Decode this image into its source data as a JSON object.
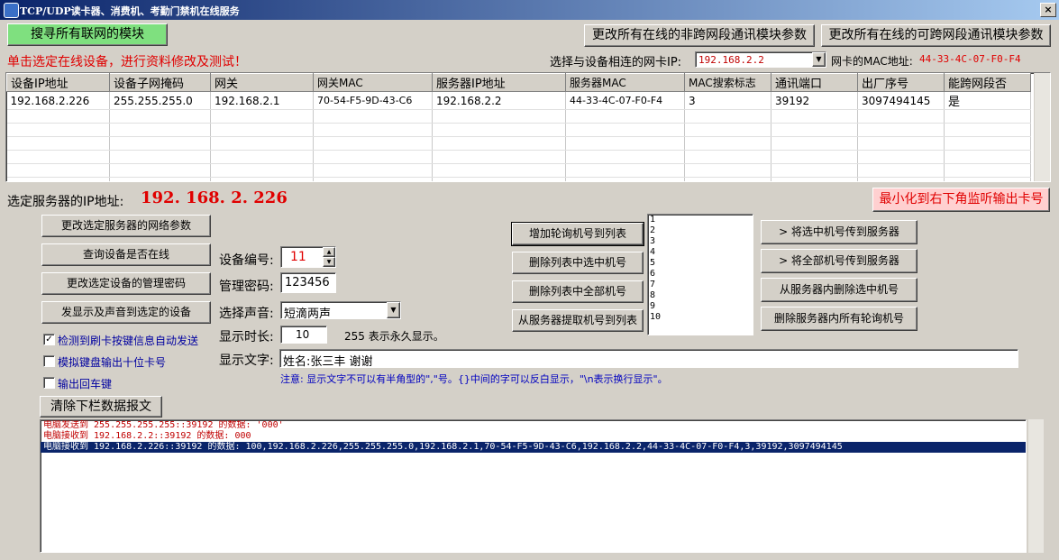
{
  "window": {
    "title": "TCP/UDP读卡器、消费机、考勤门禁机在线服务",
    "close": "×"
  },
  "top": {
    "search_button": "搜寻所有联网的模块",
    "change_non_cross": "更改所有在线的非跨网段通讯模块参数",
    "change_cross": "更改所有在线的可跨网段通讯模块参数",
    "hint": "单击选定在线设备，进行资料修改及测试！",
    "nic_ip_label": "选择与设备相连的网卡IP:",
    "nic_ip_value": "192.168.2.2",
    "nic_mac_label": "网卡的MAC地址:",
    "nic_mac_value": "44-33-4C-07-F0-F4"
  },
  "table": {
    "columns": [
      "设备IP地址",
      "设备子网掩码",
      "网关",
      "网关MAC",
      "服务器IP地址",
      "服务器MAC",
      "MAC搜索标志",
      "通讯端口",
      "出厂序号",
      "能跨网段否"
    ],
    "rows": [
      [
        "192.168.2.226",
        "255.255.255.0",
        "192.168.2.1",
        "70-54-F5-9D-43-C6",
        "192.168.2.2",
        "44-33-4C-07-F0-F4",
        "3",
        "39192",
        "3097494145",
        "是"
      ]
    ]
  },
  "selected": {
    "label": "选定服务器的IP地址:",
    "ip": "192. 168. 2. 226"
  },
  "minimize_button": "最小化到右下角监听输出卡号",
  "left_buttons": {
    "change_net": "更改选定服务器的网络参数",
    "query_online": "查询设备是否在线",
    "change_pwd": "更改选定设备的管理密码",
    "send_display": "发显示及声音到选定的设备"
  },
  "checkboxes": [
    {
      "label": "检测到刷卡按键信息自动发送",
      "checked": true,
      "mark": "✓"
    },
    {
      "label": "模拟键盘输出十位卡号",
      "checked": false,
      "mark": ""
    },
    {
      "label": "输出回车键",
      "checked": false,
      "mark": ""
    }
  ],
  "form": {
    "device_no_label": "设备编号:",
    "device_no": "11",
    "pwd_label": "管理密码:",
    "pwd": "123456",
    "sound_label": "选择声音:",
    "sound": "短滴两声",
    "duration_label": "显示时长:",
    "duration": "10",
    "duration_hint": "255 表示永久显示。",
    "text_label": "显示文字:",
    "text": "姓名:张三丰 谢谢",
    "note": "注意: 显示文字不可以有半角型的\",\"号。{}中间的字可以反白显示，\"\\n表示换行显示\"。"
  },
  "poll_buttons": {
    "add": "增加轮询机号到列表",
    "del_sel": "删除列表中选中机号",
    "del_all": "删除列表中全部机号",
    "fetch": "从服务器提取机号到列表"
  },
  "poll_list": [
    "1",
    "2",
    "3",
    "4",
    "5",
    "6",
    "7",
    "8",
    "9",
    "10"
  ],
  "server_buttons": {
    "send_sel": "> 将选中机号传到服务器",
    "send_all": "> 将全部机号传到服务器",
    "del_sel": "从服务器内删除选中机号",
    "del_all": "删除服务器内所有轮询机号"
  },
  "clear_button": "清除下栏数据报文",
  "log": [
    "电脑发送到 255.255.255.255::39192 的数据: '000'",
    "电脑接收到 192.168.2.2::39192 的数据: 000",
    "电脑接收到 192.168.2.226::39192 的数据: 100,192.168.2.226,255.255.255.0,192.168.2.1,70-54-F5-9D-43-C6,192.168.2.2,44-33-4C-07-F0-F4,3,39192,3097494145"
  ],
  "colors": {
    "accent_red": "#e00000",
    "green_button": "#7fe07f",
    "pink_button": "#ffd0d0",
    "selection": "#0a246a",
    "note_blue": "#0000c0"
  },
  "icons": {
    "dropdown": "▼",
    "spin_up": "▲",
    "spin_down": "▼",
    "scroll_up": "▲",
    "scroll_down": "▼"
  }
}
